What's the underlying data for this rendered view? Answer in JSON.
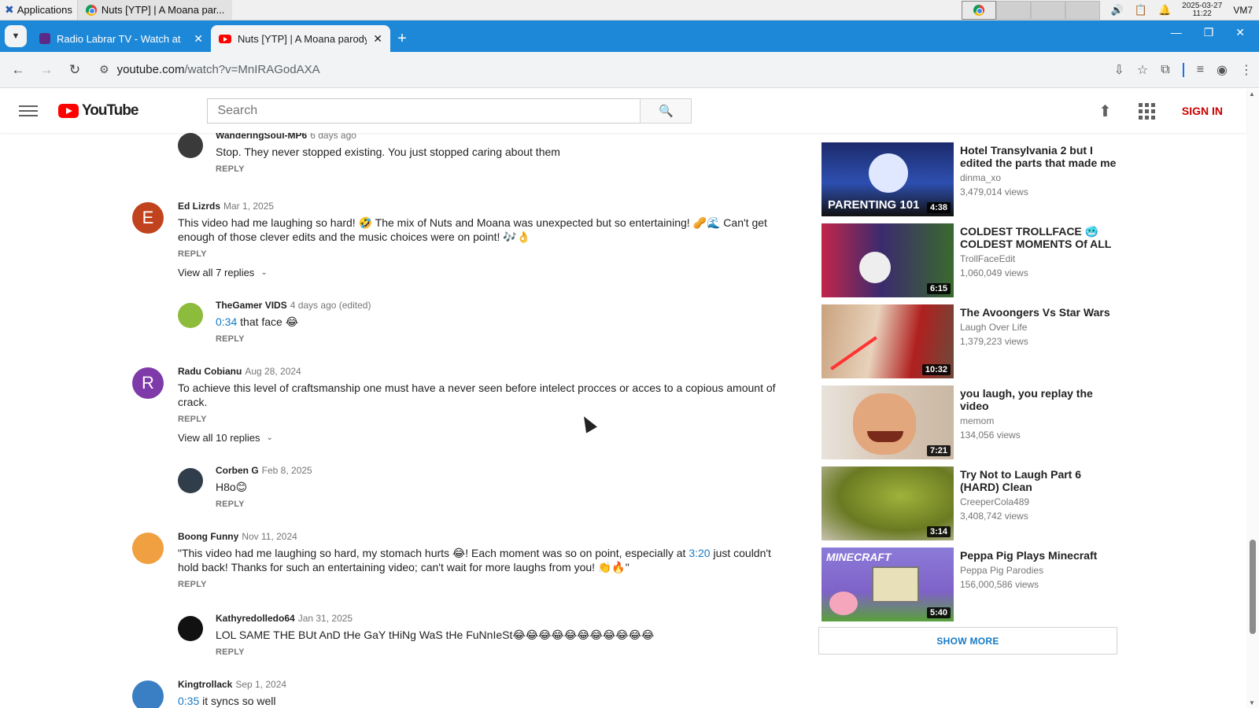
{
  "os_taskbar": {
    "applications_label": "Applications",
    "window_title": "Nuts [YTP] | A Moana par...",
    "clock_date": "2025-03-27",
    "clock_time": "11:22",
    "user": "VM7"
  },
  "browser": {
    "tabs": [
      {
        "title": "Radio Labrar TV - Watch at",
        "active": false
      },
      {
        "title": "Nuts [YTP] | A Moana parody",
        "active": true
      }
    ],
    "url_host": "youtube.com",
    "url_path": "/watch?v=MnIRAGodAXA"
  },
  "youtube": {
    "logo_text": "YouTube",
    "search_placeholder": "Search",
    "sign_in": "SIGN IN"
  },
  "comments": [
    {
      "author": "WanderingSoul-MP6",
      "date": "6 days ago",
      "text": "Stop. They never stopped existing. You just stopped caring about them",
      "reply": "REPLY",
      "avatar_letter": "",
      "avatar_color": "#3a3a3a"
    },
    {
      "author": "Ed Lizrds",
      "date": "Mar 1, 2025",
      "text": "This video had me laughing so hard! 🤣 The mix of Nuts and Moana was unexpected but so entertaining! 🥜🌊 Can't get enough of those clever edits and the music choices were on point! 🎶👌",
      "reply": "REPLY",
      "view_replies": "View all 7 replies",
      "avatar_letter": "E",
      "avatar_color": "#c0431d"
    },
    {
      "author": "TheGamer VIDS",
      "date": "4 days ago (edited)",
      "timestamp": "0:34",
      "text": "that face 😂",
      "reply": "REPLY",
      "avatar_letter": "",
      "avatar_color": "#8dbb3c"
    },
    {
      "author": "Radu Cobianu",
      "date": "Aug 28, 2024",
      "text": "To achieve this level of craftsmanship one must have a never seen before intelect procces or acces to a copious amount of crack.",
      "reply": "REPLY",
      "view_replies": "View all 10 replies",
      "avatar_letter": "R",
      "avatar_color": "#7e3aa8"
    },
    {
      "author": "Corben G",
      "date": "Feb 8, 2025",
      "text": "H8o😊",
      "reply": "REPLY",
      "avatar_letter": "",
      "avatar_color": "#2f3e4a"
    },
    {
      "author": "Boong Funny",
      "date": "Nov 11, 2024",
      "text_before": "\"This video had me laughing so hard, my stomach hurts 😂! Each moment was so on point, especially at ",
      "timestamp": "3:20",
      "text_after": " just couldn't hold back! Thanks for such an entertaining video; can't wait for more laughs from you! 👏🔥\"",
      "reply": "REPLY",
      "avatar_letter": "",
      "avatar_color": "#f0a040"
    },
    {
      "author": "Kathyredolledo64",
      "date": "Jan 31, 2025",
      "text": "LOL SAME THE BUt AnD tHe GaY tHiNg WaS tHe FuNnIeSt😂😂😂😂😂😂😂😂😂😂😂",
      "reply": "REPLY",
      "avatar_letter": "",
      "avatar_color": "#111111"
    },
    {
      "author": "Kingtrollack",
      "date": "Sep 1, 2024",
      "timestamp": "0:35",
      "text": "it syncs so well",
      "avatar_letter": "",
      "avatar_color": "#3a7fc4"
    }
  ],
  "related_videos": [
    {
      "title": "Hotel Transylvania 2 but I edited the parts that made me",
      "channel": "dinma_xo",
      "views": "3,479,014 views",
      "duration": "4:38",
      "thumb_text": "PARENTING 101",
      "thumb_color": "#1b2a6b"
    },
    {
      "title": "COLDEST TROLLFACE 🥶 COLDEST MOMENTS Of ALL",
      "channel": "TrollFaceEdit",
      "views": "1,060,049 views",
      "duration": "6:15",
      "thumb_color": "#3b2a6e"
    },
    {
      "title": "The Avoongers Vs Star Wars",
      "channel": "Laugh Over Life",
      "views": "1,379,223 views",
      "duration": "10:32",
      "thumb_color": "#b88a6a"
    },
    {
      "title": "you laugh, you replay the video",
      "channel": "memom",
      "views": "134,056 views",
      "duration": "7:21",
      "thumb_color": "#d9c9b8"
    },
    {
      "title": "Try Not to Laugh Part 6 (HARD) Clean",
      "channel": "CreeperCola489",
      "views": "3,408,742 views",
      "duration": "3:14",
      "thumb_color": "#7a8a2a"
    },
    {
      "title": "Peppa Pig Plays Minecraft",
      "channel": "Peppa Pig Parodies",
      "views": "156,000,586 views",
      "duration": "5:40",
      "thumb_text": "MINECRAFT",
      "thumb_color": "#7f62c8"
    }
  ],
  "show_more": "SHOW MORE"
}
